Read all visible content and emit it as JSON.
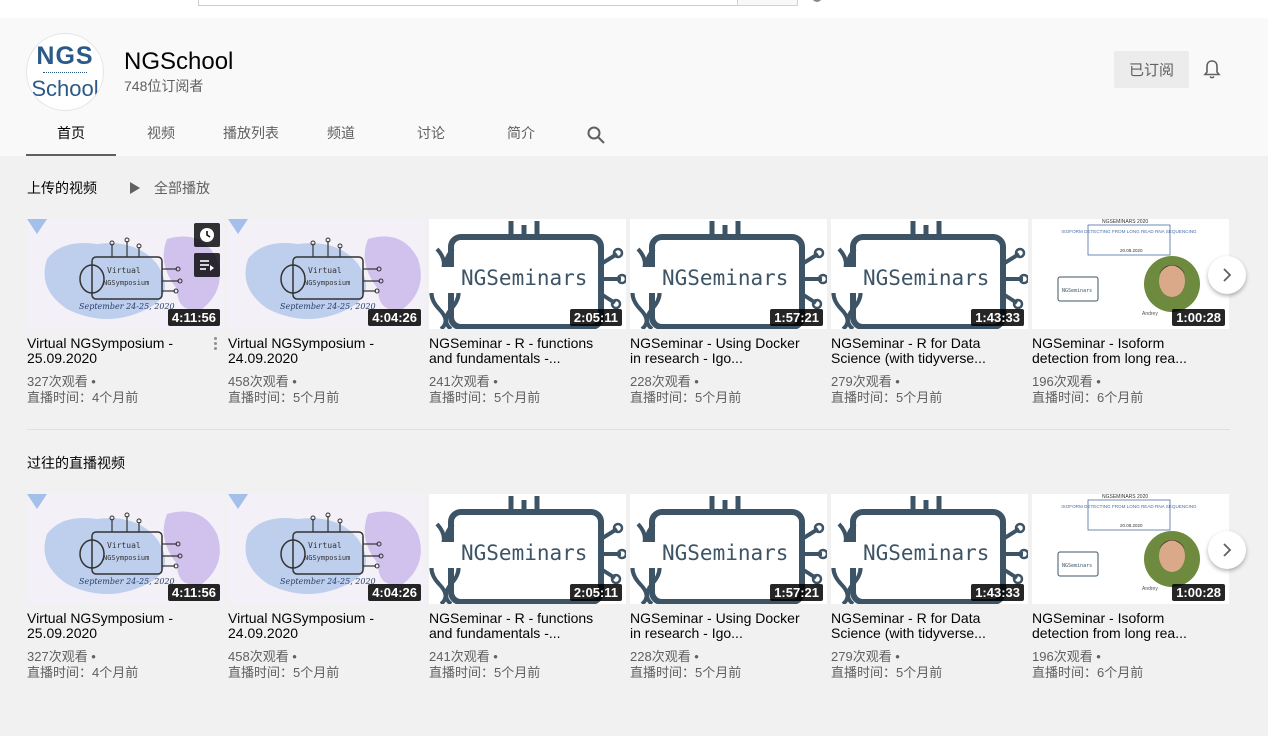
{
  "search": {
    "placeholder": ""
  },
  "channel": {
    "name": "NGSchool",
    "subscribers": "748位订阅者",
    "subscribed_label": "已订阅",
    "logo_top": "NGS",
    "logo_bottom": "School"
  },
  "tabs": [
    {
      "label": "首页",
      "active": true
    },
    {
      "label": "视频"
    },
    {
      "label": "播放列表"
    },
    {
      "label": "频道"
    },
    {
      "label": "讨论"
    },
    {
      "label": "简介"
    }
  ],
  "shelves": [
    {
      "title": "上传的视频",
      "play_all_label": "全部播放",
      "videos": [
        {
          "title": "Virtual NGSymposium - 25.09.2020",
          "duration": "4:11:56",
          "views": "327次观看 •",
          "time": "直播时间：4个月前",
          "thumb": "symposium"
        },
        {
          "title": "Virtual NGSymposium - 24.09.2020",
          "duration": "4:04:26",
          "views": "458次观看 •",
          "time": "直播时间：5个月前",
          "thumb": "symposium"
        },
        {
          "title": "NGSeminar - R - functions and fundamentals -...",
          "duration": "2:05:11",
          "views": "241次观看 •",
          "time": "直播时间：5个月前",
          "thumb": "seminar"
        },
        {
          "title": "NGSeminar - Using Docker in research - Igo...",
          "duration": "1:57:21",
          "views": "228次观看 •",
          "time": "直播时间：5个月前",
          "thumb": "seminar"
        },
        {
          "title": "NGSeminar - R for Data Science (with tidyverse...",
          "duration": "1:43:33",
          "views": "279次观看 •",
          "time": "直播时间：5个月前",
          "thumb": "seminar"
        },
        {
          "title": "NGSeminar - Isoform detection from long rea...",
          "duration": "1:00:28",
          "views": "196次观看 •",
          "time": "直播时间：6个月前",
          "thumb": "isoform"
        }
      ]
    },
    {
      "title": "过往的直播视频",
      "videos": [
        {
          "title": "Virtual NGSymposium - 25.09.2020",
          "duration": "4:11:56",
          "views": "327次观看 •",
          "time": "直播时间：4个月前",
          "thumb": "symposium"
        },
        {
          "title": "Virtual NGSymposium - 24.09.2020",
          "duration": "4:04:26",
          "views": "458次观看 •",
          "time": "直播时间：5个月前",
          "thumb": "symposium"
        },
        {
          "title": "NGSeminar - R - functions and fundamentals -...",
          "duration": "2:05:11",
          "views": "241次观看 •",
          "time": "直播时间：5个月前",
          "thumb": "seminar"
        },
        {
          "title": "NGSeminar - Using Docker in research - Igo...",
          "duration": "1:57:21",
          "views": "228次观看 •",
          "time": "直播时间：5个月前",
          "thumb": "seminar"
        },
        {
          "title": "NGSeminar - R for Data Science (with tidyverse...",
          "duration": "1:43:33",
          "views": "279次观看 •",
          "time": "直播时间：5个月前",
          "thumb": "seminar"
        },
        {
          "title": "NGSeminar - Isoform detection from long rea...",
          "duration": "1:00:28",
          "views": "196次观看 •",
          "time": "直播时间：6个月前",
          "thumb": "isoform"
        }
      ]
    }
  ],
  "thumb_text": {
    "symposium_line1": "Virtual",
    "symposium_line2": "NGSymposium",
    "symposium_date": "September 24-25, 2020",
    "seminar_label": "NGSeminars",
    "isoform_header": "NGSEMINARS 2020",
    "isoform_title": "ISOFORM DETECTING FROM LONG READ RNA SEQUENCING",
    "isoform_date": "20.08.2020",
    "isoform_small": "NGSeminars",
    "isoform_name": "Andrey"
  },
  "colors": {
    "seminar_ink": "#3d5466",
    "blob_blue": "#8fb3e6",
    "blob_purple": "#b9a3e6"
  }
}
